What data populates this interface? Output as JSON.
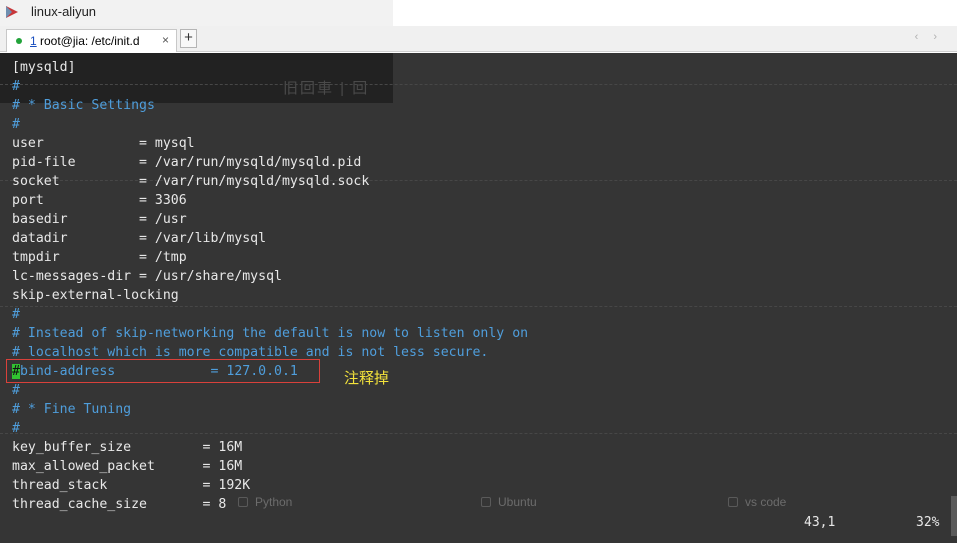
{
  "window": {
    "title": "linux-aliyun"
  },
  "tabs": [
    {
      "number": "1",
      "label": " root@jia: /etc/init.d",
      "close": "×"
    }
  ],
  "new_tab_label": "+",
  "nav": {
    "arrows": "‹ ›"
  },
  "ghost": {
    "text": "旧回車 | 回"
  },
  "terminal": {
    "lines": [
      {
        "text": "[mysqld]",
        "kind": "normal"
      },
      {
        "text": "#",
        "kind": "comment"
      },
      {
        "text": "# * Basic Settings",
        "kind": "comment"
      },
      {
        "text": "#",
        "kind": "comment"
      },
      {
        "text": "user            = mysql",
        "kind": "normal"
      },
      {
        "text": "pid-file        = /var/run/mysqld/mysqld.pid",
        "kind": "normal"
      },
      {
        "text": "socket          = /var/run/mysqld/mysqld.sock",
        "kind": "normal"
      },
      {
        "text": "port            = 3306",
        "kind": "normal"
      },
      {
        "text": "basedir         = /usr",
        "kind": "normal"
      },
      {
        "text": "datadir         = /var/lib/mysql",
        "kind": "normal"
      },
      {
        "text": "tmpdir          = /tmp",
        "kind": "normal"
      },
      {
        "text": "lc-messages-dir = /usr/share/mysql",
        "kind": "normal"
      },
      {
        "text": "skip-external-locking",
        "kind": "normal"
      },
      {
        "text": "#",
        "kind": "comment"
      },
      {
        "text": "# Instead of skip-networking the default is now to listen only on",
        "kind": "comment"
      },
      {
        "text": "# localhost which is more compatible and is not less secure.",
        "kind": "comment"
      },
      {
        "text": "bind-address            = 127.0.0.1",
        "kind": "comment",
        "cursor": "#"
      },
      {
        "text": "#",
        "kind": "comment"
      },
      {
        "text": "# * Fine Tuning",
        "kind": "comment"
      },
      {
        "text": "#",
        "kind": "comment"
      },
      {
        "text": "key_buffer_size         = 16M",
        "kind": "normal"
      },
      {
        "text": "max_allowed_packet      = 16M",
        "kind": "normal"
      },
      {
        "text": "thread_stack            = 192K",
        "kind": "normal"
      },
      {
        "text": "thread_cache_size       = 8",
        "kind": "normal"
      }
    ],
    "annotation": "注释掉",
    "status": {
      "position": "43,1",
      "percent": "32%"
    },
    "ghost_options": [
      "Python",
      "Ubuntu",
      "vs code"
    ]
  },
  "colors": {
    "terminal_bg": "#353535",
    "comment": "#4f9edc",
    "cursor": "#31c331",
    "highlight": "#d9413b",
    "annotation": "#f3e23b"
  }
}
